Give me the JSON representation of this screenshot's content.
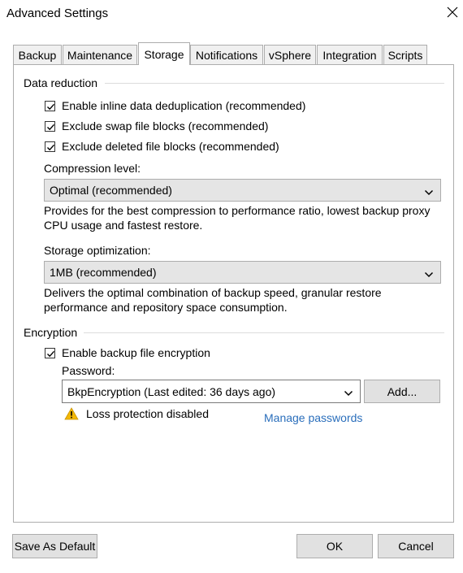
{
  "window": {
    "title": "Advanced Settings"
  },
  "tabs": [
    {
      "label": "Backup"
    },
    {
      "label": "Maintenance"
    },
    {
      "label": "Storage",
      "active": true
    },
    {
      "label": "Notifications"
    },
    {
      "label": "vSphere"
    },
    {
      "label": "Integration"
    },
    {
      "label": "Scripts"
    }
  ],
  "data_reduction": {
    "heading": "Data reduction",
    "options": [
      {
        "label": "Enable inline data deduplication (recommended)",
        "checked": true
      },
      {
        "label": "Exclude swap file blocks (recommended)",
        "checked": true
      },
      {
        "label": "Exclude deleted file blocks (recommended)",
        "checked": true
      }
    ],
    "compression_label": "Compression level:",
    "compression_value": "Optimal (recommended)",
    "compression_desc_1": "Provides for the best compression to performance ratio, lowest backup proxy",
    "compression_desc_2": "CPU usage and fastest restore.",
    "storage_opt_label": "Storage optimization:",
    "storage_opt_value": "1MB (recommended)",
    "storage_opt_desc_1": "Delivers the optimal combination of backup speed, granular restore",
    "storage_opt_desc_2": "performance and repository space consumption."
  },
  "encryption": {
    "heading": "Encryption",
    "enable_label": "Enable backup file encryption",
    "enable_checked": true,
    "password_label": "Password:",
    "password_value": "BkpEncryption (Last edited: 36 days ago)",
    "add_button": "Add...",
    "warning_text": "Loss protection disabled",
    "manage_link": "Manage passwords"
  },
  "footer": {
    "save_default": "Save As Default",
    "ok": "OK",
    "cancel": "Cancel"
  },
  "colors": {
    "link": "#2a6ebb",
    "warning": "#f2b705",
    "select_bg": "#e5e5e5"
  }
}
